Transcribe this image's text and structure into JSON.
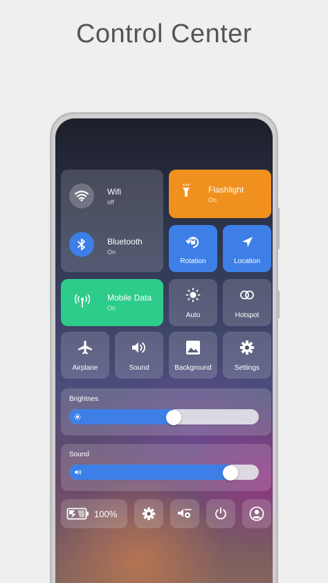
{
  "page_title": "Control Center",
  "tiles": {
    "wifi": {
      "label": "Wifi",
      "status": "off",
      "icon": "wifi-icon"
    },
    "bluetooth": {
      "label": "Bluetooth",
      "status": "On",
      "icon": "bluetooth-icon"
    },
    "flashlight": {
      "label": "Flashlight",
      "status": "On",
      "icon": "flashlight-icon",
      "color": "#f0901e"
    },
    "rotation": {
      "label": "Rotation",
      "icon": "rotation-icon",
      "color": "#3d7fe6"
    },
    "location": {
      "label": "Location",
      "icon": "location-icon",
      "color": "#3d7fe6"
    },
    "mobile_data": {
      "label": "Mobile Data",
      "status": "On",
      "icon": "antenna-icon",
      "color": "#2ecc8b"
    },
    "auto": {
      "label": "Auto",
      "icon": "sun-icon"
    },
    "hotspot": {
      "label": "Hotspot",
      "icon": "hotspot-icon"
    },
    "airplane": {
      "label": "Airplane",
      "icon": "airplane-icon"
    },
    "sound": {
      "label": "Sound",
      "icon": "speaker-icon"
    },
    "background": {
      "label": "Background",
      "icon": "image-icon"
    },
    "settings": {
      "label": "Settings",
      "icon": "gear-icon"
    }
  },
  "sliders": {
    "brightness": {
      "label": "Brightnes",
      "value_fraction": 0.55,
      "icon": "sun-small-icon"
    },
    "sound": {
      "label": "Sound",
      "value_fraction": 0.85,
      "icon": "speaker-small-icon"
    }
  },
  "bottom_bar": {
    "battery_percent": "100%",
    "battery_icon": "battery-charging-icon",
    "buttons": [
      "gear-icon",
      "brightness-mode-icon",
      "power-icon",
      "user-icon"
    ]
  },
  "colors": {
    "accent_blue": "#3d7fe6",
    "orange": "#f0901e",
    "green": "#2ecc8b"
  }
}
